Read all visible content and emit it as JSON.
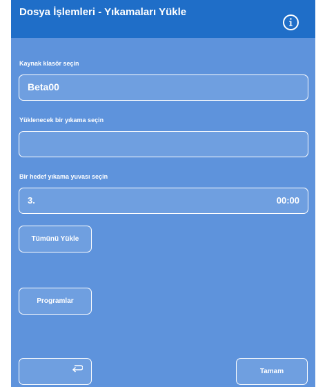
{
  "header": {
    "title": "Dosya İşlemleri - Yıkamaları Yükle"
  },
  "source_folder": {
    "label": "Kaynak klasör seçin",
    "value": "Beta00"
  },
  "wash_to_load": {
    "label": "Yüklenecek bir yıkama seçin",
    "value": ""
  },
  "target_slot": {
    "label": "Bir hedef yıkama yuvası seçin",
    "value": "3.",
    "time": "00:00"
  },
  "buttons": {
    "load_all": "Tümünü Yükle",
    "programs": "Programlar",
    "ok": "Tamam"
  },
  "icons": {
    "info": "info-icon",
    "back": "back-arrow-icon"
  },
  "colors": {
    "title_bar": "#1f6ec8",
    "panel": "#5e93dc",
    "text": "#ffffff"
  }
}
